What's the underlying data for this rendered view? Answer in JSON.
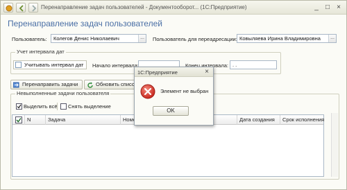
{
  "window": {
    "title": "Перенаправление задач пользователей - Документооборот... (1С:Предприятие)",
    "minimize_glyph": "_",
    "maximize_glyph": "□",
    "close_glyph": "×"
  },
  "form": {
    "title": "Перенаправление задач пользователей",
    "user_label": "Пользователь:",
    "user_value": "Колегов Денис Николаевич",
    "target_user_label": "Пользователь для переадресации:",
    "target_user_value": "Ковыляева Ирина Владимировна",
    "field_button_glyph": "...",
    "interval_group": {
      "caption": "Учет интервала дат",
      "checkbox_label": "Учитывать интервал дат",
      "checkbox_checked": false,
      "start_label": "Начало интервала:",
      "start_value": "",
      "end_label": "Конец интервала:",
      "end_value": ". ."
    },
    "buttons": {
      "redirect": "Перенаправить задачи",
      "refresh": "Обновить список"
    },
    "tasks_group": {
      "caption": "Невыполненные задачи пользователя",
      "select_all": "Выделить всё",
      "clear_selection": "Снять выделение",
      "columns": [
        "N",
        "Задача",
        "Номе",
        "Дата создания",
        "Срок исполнения"
      ]
    }
  },
  "dialog": {
    "title": "1С:Предприятие",
    "message": "Элемент не выбран",
    "ok_label": "OK",
    "close_glyph": "×",
    "icon": "error-icon",
    "icon_color": "#d9302c"
  },
  "colors": {
    "form_title": "#4a6fa5",
    "background": "#fbfbf6"
  }
}
